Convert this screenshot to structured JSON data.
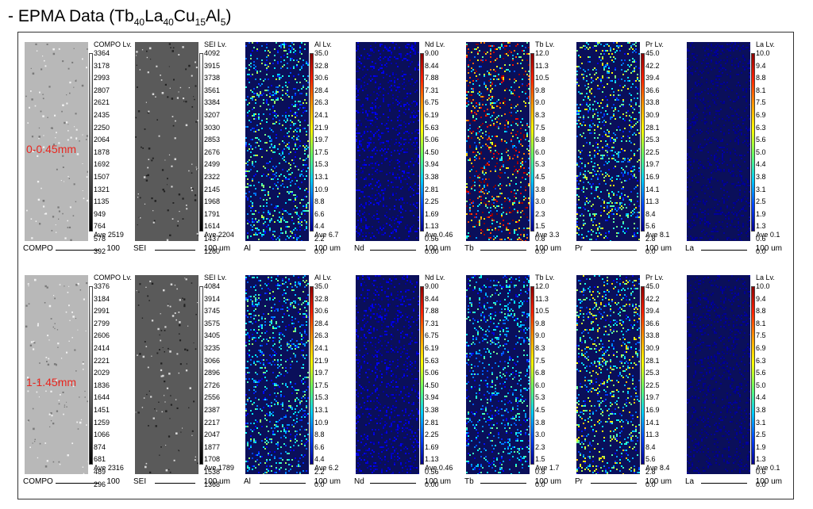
{
  "title": {
    "prefix": "- EPMA Data (",
    "parts": [
      {
        "t": "Tb",
        "s": "40"
      },
      {
        "t": "La",
        "s": "40"
      },
      {
        "t": "Cu",
        "s": "15"
      },
      {
        "t": "Al",
        "s": "5"
      }
    ],
    "suffix": ")"
  },
  "colors": {
    "depth_label": "#e8261f",
    "compo_bg": "#b8b8b8",
    "sei_bg": "#5a5a5a",
    "map_bg": "#0a0f5a"
  },
  "rows": [
    {
      "depth": "0-0.45mm",
      "panels": [
        {
          "element": "COMPO",
          "lv": "COMPO  Lv.",
          "scale": "100",
          "ave": "Ave 2519",
          "kind": "compo",
          "intensity": 0.0,
          "ticks": [
            "3364",
            "3178",
            "2993",
            "2807",
            "2621",
            "2435",
            "2250",
            "2064",
            "1878",
            "1692",
            "1507",
            "1321",
            "1135",
            "949",
            "764",
            "578",
            "392"
          ]
        },
        {
          "element": "SEI",
          "lv": "SEI  Lv.",
          "scale": "100 um",
          "ave": "Ave 2204",
          "kind": "sei",
          "intensity": 0.0,
          "ticks": [
            "4092",
            "3915",
            "3738",
            "3561",
            "3384",
            "3207",
            "3030",
            "2853",
            "2676",
            "2499",
            "2322",
            "2145",
            "1968",
            "1791",
            "1614",
            "1437",
            "1260"
          ]
        },
        {
          "element": "Al",
          "lv": "Al  Lv.",
          "scale": "100 um",
          "ave": "Ave 6.7",
          "kind": "map",
          "intensity": 0.35,
          "ticks": [
            "35.0",
            "32.8",
            "30.6",
            "28.4",
            "26.3",
            "24.1",
            "21.9",
            "19.7",
            "17.5",
            "15.3",
            "13.1",
            "10.9",
            "8.8",
            "6.6",
            "4.4",
            "2.2",
            "0.0"
          ]
        },
        {
          "element": "Nd",
          "lv": "Nd  Lv.",
          "scale": "100 um",
          "ave": "Ave 0.46",
          "kind": "map",
          "intensity": 0.08,
          "ticks": [
            "9.00",
            "8.44",
            "7.88",
            "7.31",
            "6.75",
            "6.19",
            "5.63",
            "5.06",
            "4.50",
            "3.94",
            "3.38",
            "2.81",
            "2.25",
            "1.69",
            "1.13",
            "0.56",
            "0.00"
          ]
        },
        {
          "element": "Tb",
          "lv": "Tb  Lv.",
          "scale": "100 um",
          "ave": "Ave 3.3",
          "kind": "map",
          "intensity": 0.7,
          "ticks": [
            "12.0",
            "11.3",
            "10.5",
            "9.8",
            "9.0",
            "8.3",
            "7.5",
            "6.8",
            "6.0",
            "5.3",
            "4.5",
            "3.8",
            "3.0",
            "2.3",
            "1.5",
            "0.8",
            "0.0"
          ]
        },
        {
          "element": "Pr",
          "lv": "Pr  Lv.",
          "scale": "100 um",
          "ave": "Ave 8.1",
          "kind": "map",
          "intensity": 0.4,
          "ticks": [
            "45.0",
            "42.2",
            "39.4",
            "36.6",
            "33.8",
            "30.9",
            "28.1",
            "25.3",
            "22.5",
            "19.7",
            "16.9",
            "14.1",
            "11.3",
            "8.4",
            "5.6",
            "2.8",
            "0.0"
          ]
        },
        {
          "element": "La",
          "lv": "La  Lv.",
          "scale": "100 um",
          "ave": "Ave 0.1",
          "kind": "map",
          "intensity": 0.02,
          "ticks": [
            "10.0",
            "9.4",
            "8.8",
            "8.1",
            "7.5",
            "6.9",
            "6.3",
            "5.6",
            "5.0",
            "4.4",
            "3.8",
            "3.1",
            "2.5",
            "1.9",
            "1.3",
            "0.6",
            "0.0"
          ]
        }
      ]
    },
    {
      "depth": "1-1.45mm",
      "panels": [
        {
          "element": "COMPO",
          "lv": "COMPO  Lv.",
          "scale": "100",
          "ave": "Ave 2316",
          "kind": "compo",
          "intensity": 0.0,
          "ticks": [
            "3376",
            "3184",
            "2991",
            "2799",
            "2606",
            "2414",
            "2221",
            "2029",
            "1836",
            "1644",
            "1451",
            "1259",
            "1066",
            "874",
            "681",
            "489",
            "296"
          ]
        },
        {
          "element": "SEI",
          "lv": "SEI  Lv.",
          "scale": "100 um",
          "ave": "Ave 1789",
          "kind": "sei",
          "intensity": 0.0,
          "ticks": [
            "4084",
            "3914",
            "3745",
            "3575",
            "3405",
            "3235",
            "3066",
            "2896",
            "2726",
            "2556",
            "2387",
            "2217",
            "2047",
            "1877",
            "1708",
            "1538",
            "1368"
          ]
        },
        {
          "element": "Al",
          "lv": "Al  Lv.",
          "scale": "100 um",
          "ave": "Ave 6.2",
          "kind": "map",
          "intensity": 0.33,
          "ticks": [
            "35.0",
            "32.8",
            "30.6",
            "28.4",
            "26.3",
            "24.1",
            "21.9",
            "19.7",
            "17.5",
            "15.3",
            "13.1",
            "10.9",
            "8.8",
            "6.6",
            "4.4",
            "2.2",
            "0.0"
          ]
        },
        {
          "element": "Nd",
          "lv": "Nd  Lv.",
          "scale": "100 um",
          "ave": "Ave 0.46",
          "kind": "map",
          "intensity": 0.08,
          "ticks": [
            "9.00",
            "8.44",
            "7.88",
            "7.31",
            "6.75",
            "6.19",
            "5.63",
            "5.06",
            "4.50",
            "3.94",
            "3.38",
            "2.81",
            "2.25",
            "1.69",
            "1.13",
            "0.56",
            "0.00"
          ]
        },
        {
          "element": "Tb",
          "lv": "Tb  Lv.",
          "scale": "100 um",
          "ave": "Ave 1.7",
          "kind": "map",
          "intensity": 0.3,
          "ticks": [
            "12.0",
            "11.3",
            "10.5",
            "9.8",
            "9.0",
            "8.3",
            "7.5",
            "6.8",
            "6.0",
            "5.3",
            "4.5",
            "3.8",
            "3.0",
            "2.3",
            "1.5",
            "0.8",
            "0.0"
          ]
        },
        {
          "element": "Pr",
          "lv": "Pr  Lv.",
          "scale": "100 um",
          "ave": "Ave 8.4",
          "kind": "map",
          "intensity": 0.42,
          "ticks": [
            "45.0",
            "42.2",
            "39.4",
            "36.6",
            "33.8",
            "30.9",
            "28.1",
            "25.3",
            "22.5",
            "19.7",
            "16.9",
            "14.1",
            "11.3",
            "8.4",
            "5.6",
            "2.8",
            "0.0"
          ]
        },
        {
          "element": "La",
          "lv": "La  Lv.",
          "scale": "100 um",
          "ave": "Ave 0.1",
          "kind": "map",
          "intensity": 0.02,
          "ticks": [
            "10.0",
            "9.4",
            "8.8",
            "8.1",
            "7.5",
            "6.9",
            "6.3",
            "5.6",
            "5.0",
            "4.4",
            "3.8",
            "3.1",
            "2.5",
            "1.9",
            "1.3",
            "0.6",
            "0.0"
          ]
        }
      ]
    }
  ]
}
